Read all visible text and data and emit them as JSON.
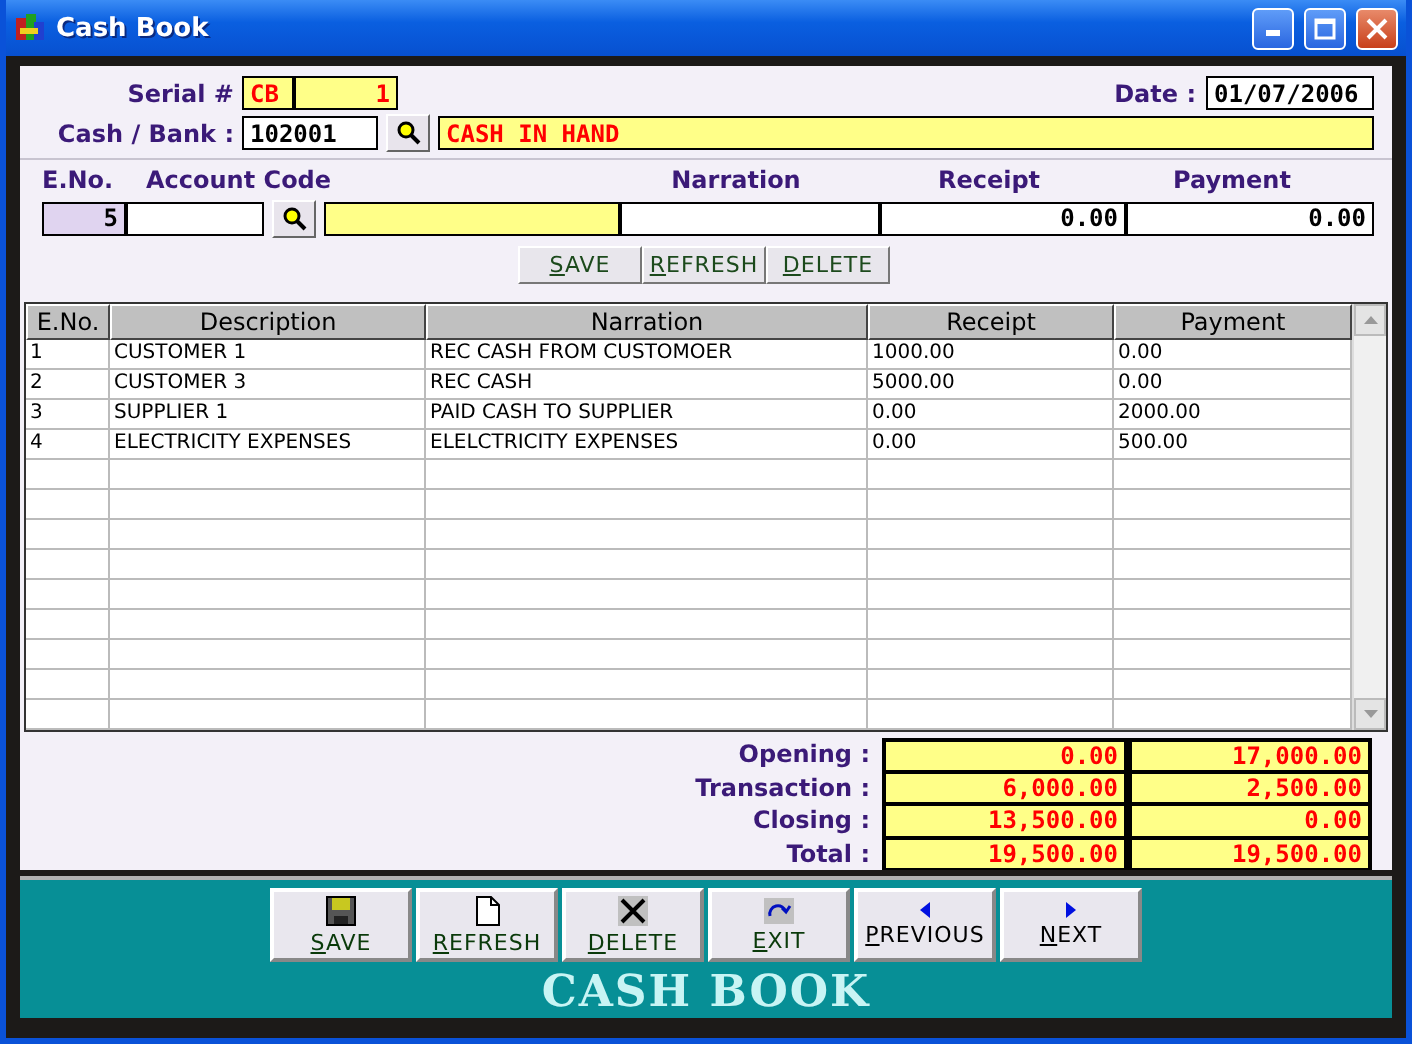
{
  "window": {
    "title": "Cash Book"
  },
  "header": {
    "serial_label": "Serial #",
    "serial_prefix": "CB",
    "serial_number": "1",
    "date_label": "Date :",
    "date": "01/07/2006",
    "cash_bank_label": "Cash / Bank :",
    "cash_bank_code": "102001",
    "cash_bank_name": "CASH IN HAND"
  },
  "entry": {
    "labels": [
      "E.No.",
      "Account Code",
      "Narration",
      "Receipt",
      "Payment"
    ],
    "eno": "5",
    "receipt": "0.00",
    "payment": "0.00"
  },
  "entry_buttons": [
    "SAVE",
    "REFRESH",
    "DELETE"
  ],
  "table": {
    "columns": [
      "E.No.",
      "Description",
      "Narration",
      "Receipt",
      "Payment"
    ],
    "rows": [
      [
        "1",
        "CUSTOMER 1",
        "REC CASH FROM CUSTOMOER",
        "1000.00",
        "0.00"
      ],
      [
        "2",
        "CUSTOMER 3",
        "REC CASH",
        "5000.00",
        "0.00"
      ],
      [
        "3",
        "SUPPLIER 1",
        "PAID CASH TO SUPPLIER",
        "0.00",
        "2000.00"
      ],
      [
        "4",
        "ELECTRICITY EXPENSES",
        "ELELCTRICITY EXPENSES",
        "0.00",
        "500.00"
      ]
    ]
  },
  "totals": [
    {
      "label": "Opening :",
      "receipt": "0.00",
      "payment": "17,000.00"
    },
    {
      "label": "Transaction :",
      "receipt": "6,000.00",
      "payment": "2,500.00"
    },
    {
      "label": "Closing :",
      "receipt": "13,500.00",
      "payment": "0.00"
    },
    {
      "label": "Total :",
      "receipt": "19,500.00",
      "payment": "19,500.00"
    }
  ],
  "toolbar": [
    {
      "kind": "save",
      "label": "SAVE"
    },
    {
      "kind": "refresh",
      "label": "REFRESH"
    },
    {
      "kind": "delete",
      "label": "DELETE"
    },
    {
      "kind": "exit",
      "label": "EXIT"
    },
    {
      "kind": "previous",
      "label": "PREVIOUS"
    },
    {
      "kind": "next",
      "label": "NEXT"
    }
  ],
  "footer_title": "CASH BOOK"
}
